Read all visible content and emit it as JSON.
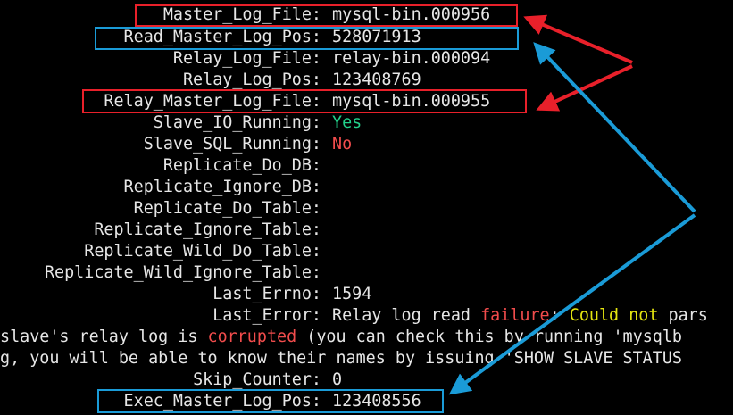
{
  "colors": {
    "background": "#000000",
    "text": "#e6e6e6",
    "yes": "#23d18b",
    "no": "#f14c4c",
    "highlight_red": "#e8202a",
    "highlight_blue": "#1a9bd7",
    "warning_yellow": "#e5e510"
  },
  "status": {
    "master_log_file": {
      "label": "Master_Log_File:",
      "value": "mysql-bin.000956"
    },
    "read_master_log_pos": {
      "label": "Read_Master_Log_Pos:",
      "value": "528071913"
    },
    "relay_log_file": {
      "label": "Relay_Log_File:",
      "value": "relay-bin.000094"
    },
    "relay_log_pos": {
      "label": "Relay_Log_Pos:",
      "value": "123408769"
    },
    "relay_master_log_file": {
      "label": "Relay_Master_Log_File:",
      "value": "mysql-bin.000955"
    },
    "slave_io_running": {
      "label": "Slave_IO_Running:",
      "value": "Yes"
    },
    "slave_sql_running": {
      "label": "Slave_SQL_Running:",
      "value": "No"
    },
    "replicate_do_db": {
      "label": "Replicate_Do_DB:",
      "value": ""
    },
    "replicate_ignore_db": {
      "label": "Replicate_Ignore_DB:",
      "value": ""
    },
    "replicate_do_table": {
      "label": "Replicate_Do_Table:",
      "value": ""
    },
    "replicate_ignore_table": {
      "label": "Replicate_Ignore_Table:",
      "value": ""
    },
    "replicate_wild_do_table": {
      "label": "Replicate_Wild_Do_Table:",
      "value": ""
    },
    "replicate_wild_ignore_table": {
      "label": "Replicate_Wild_Ignore_Table:",
      "value": ""
    },
    "last_errno": {
      "label": "Last_Errno:",
      "value": "1594"
    },
    "last_error": {
      "label": "Last_Error:",
      "part1": "Relay log read ",
      "failure": "failure",
      "part2": ": ",
      "could": "Could",
      "part3": " ",
      "not": "not",
      "part4": " pars"
    },
    "error_cont_1": {
      "part1": "slave's relay log is ",
      "corrupted": "corrupted",
      "part2": " (you can check this by running 'mysqlb"
    },
    "error_cont_2": "g, you will be able to know their names by issuing 'SHOW SLAVE STATUS",
    "skip_counter": {
      "label": "Skip_Counter:",
      "value": "0"
    },
    "exec_master_log_pos": {
      "label": "Exec_Master_Log_Pos:",
      "value": "123408556"
    }
  }
}
